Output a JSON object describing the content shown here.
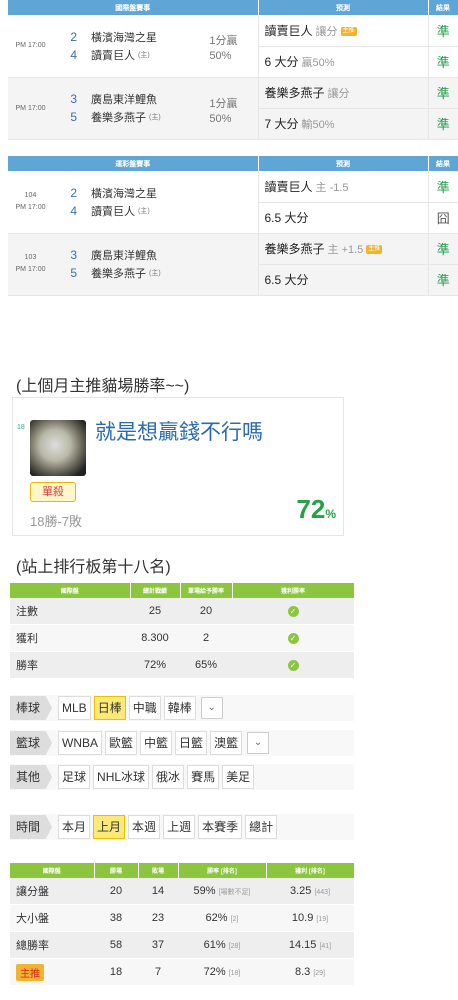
{
  "intl": {
    "headers": [
      "國際盤賽事",
      "預測",
      "結果"
    ],
    "games": [
      {
        "time": "PM 17:00",
        "away_num": "2",
        "away": "橫濱海灣之星",
        "home_num": "4",
        "home": "讀賣巨人",
        "home_tag": "(主)",
        "score1": "1分贏",
        "score2": "50%",
        "pred1": "讀賣巨人",
        "pred1_sub": "讓分",
        "pred1_tag": "主推",
        "res1": "準",
        "pred2": "6 大分",
        "pred2_sub": "贏50%",
        "res2": "準"
      },
      {
        "time": "PM 17:00",
        "away_num": "3",
        "away": "廣島東洋鯉魚",
        "home_num": "5",
        "home": "養樂多燕子",
        "home_tag": "(主)",
        "score1": "1分贏",
        "score2": "50%",
        "pred1": "養樂多燕子",
        "pred1_sub": "讓分",
        "pred1_tag": "",
        "res1": "準",
        "pred2": "7 大分",
        "pred2_sub": "輸50%",
        "res2": "準"
      }
    ]
  },
  "lottery": {
    "headers": [
      "運彩盤賽事",
      "預測",
      "結果"
    ],
    "games": [
      {
        "num": "104",
        "time": "PM 17:00",
        "away_num": "2",
        "away": "橫濱海灣之星",
        "home_num": "4",
        "home": "讀賣巨人",
        "home_tag": "(主)",
        "pred1": "讀賣巨人",
        "pred1_sub": "主 -1.5",
        "pred1_tag": "",
        "res1": "準",
        "pred2": "6.5 大分",
        "res2": "囧"
      },
      {
        "num": "103",
        "time": "PM 17:00",
        "away_num": "3",
        "away": "廣島東洋鯉魚",
        "home_num": "5",
        "home": "養樂多燕子",
        "home_tag": "(主)",
        "pred1": "養樂多燕子",
        "pred1_sub": "主 +1.5",
        "pred1_tag": "主推",
        "res1": "準",
        "pred2": "6.5 大分",
        "res2": "準"
      }
    ]
  },
  "last_month_title": "(上個月主推貓場勝率~~)",
  "card": {
    "rank": "18",
    "name": "就是想贏錢不行嗎",
    "badge": "單殺",
    "record": "18勝-7敗",
    "pct": "72",
    "pct_unit": "%"
  },
  "rank_title": "(站上排行板第十八名)",
  "stats": {
    "headers": [
      "國際盤",
      "總計戰績",
      "單場給予勝率",
      "獲利勝率"
    ],
    "rows": [
      {
        "label": "注數",
        "a": "25",
        "b": "20"
      },
      {
        "label": "獲利",
        "a": "8.300",
        "b": "2"
      },
      {
        "label": "勝率",
        "a": "72%",
        "b": "65%"
      }
    ]
  },
  "filters": {
    "baseball": {
      "label": "棒球",
      "items": [
        "MLB",
        "日棒",
        "中職",
        "韓棒"
      ],
      "active": "日棒"
    },
    "basketball": {
      "label": "籃球",
      "items": [
        "WNBA",
        "歐籃",
        "中籃",
        "日籃",
        "澳籃"
      ]
    },
    "other": {
      "label": "其他",
      "items": [
        "足球",
        "NHL冰球",
        "俄冰",
        "賽馬",
        "美足"
      ]
    },
    "time": {
      "label": "時間",
      "items": [
        "本月",
        "上月",
        "本週",
        "上週",
        "本賽季",
        "總計"
      ],
      "active": "上月"
    }
  },
  "bottom": {
    "headers": [
      "國際盤",
      "勝場",
      "敗場",
      "勝率 [排名]",
      "獲利 [排名]"
    ],
    "rows": [
      {
        "label": "讓分盤",
        "w": "20",
        "l": "14",
        "rate": "59%",
        "rate_rank": "[場數不足]",
        "profit": "3.25",
        "profit_rank": "[443]"
      },
      {
        "label": "大小盤",
        "w": "38",
        "l": "23",
        "rate": "62%",
        "rate_rank": "[2]",
        "profit": "10.9",
        "profit_rank": "[19]"
      },
      {
        "label": "總勝率",
        "w": "58",
        "l": "37",
        "rate": "61%",
        "rate_rank": "[28]",
        "profit": "14.15",
        "profit_rank": "[41]"
      },
      {
        "label": "主推",
        "w": "18",
        "l": "7",
        "rate": "72%",
        "rate_rank": "[18]",
        "profit": "8.3",
        "profit_rank": "[29]"
      }
    ]
  }
}
